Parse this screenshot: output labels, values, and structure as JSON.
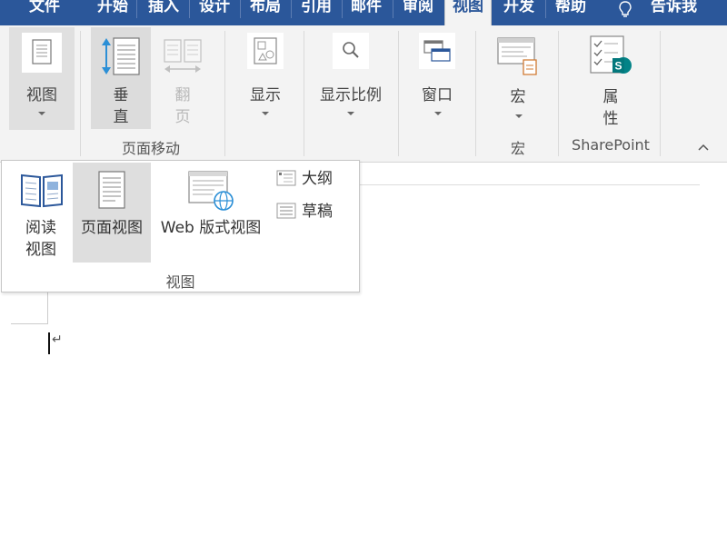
{
  "menu": {
    "tabs": [
      {
        "label": "文件",
        "active": false
      },
      {
        "label": "开始",
        "active": false
      },
      {
        "label": "插入",
        "active": false
      },
      {
        "label": "设计",
        "active": false
      },
      {
        "label": "布局",
        "active": false
      },
      {
        "label": "引用",
        "active": false
      },
      {
        "label": "邮件",
        "active": false
      },
      {
        "label": "审阅",
        "active": false
      },
      {
        "label": "视图",
        "active": true
      },
      {
        "label": "开发",
        "active": false
      },
      {
        "label": "帮助",
        "active": false
      }
    ],
    "tell_me": "告诉我",
    "tell_me_icon": "lightbulb-icon"
  },
  "ribbon": {
    "view_button": {
      "label": "视图",
      "icon": "document-view-icon"
    },
    "page_movement": {
      "group_label": "页面移动",
      "vertical": {
        "label_line1": "垂",
        "label_line2": "直",
        "icon": "vertical-scroll-icon"
      },
      "side_to_side": {
        "label_line1": "翻",
        "label_line2": "页",
        "icon": "side-by-side-icon",
        "enabled": false
      }
    },
    "show_button": {
      "label": "显示",
      "icon": "show-icon"
    },
    "zoom_button": {
      "label": "显示比例",
      "icon": "zoom-icon"
    },
    "window_button": {
      "label": "窗口",
      "icon": "window-icon"
    },
    "macros": {
      "button_label": "宏",
      "group_label": "宏",
      "icon": "macro-icon"
    },
    "sharepoint": {
      "button_line1": "属",
      "button_line2": "性",
      "group_label": "SharePoint",
      "icon": "sharepoint-properties-icon"
    },
    "collapse_icon": "chevron-up-icon"
  },
  "views_panel": {
    "group_label": "视图",
    "read_mode": {
      "label_line1": "阅读",
      "label_line2": "视图",
      "icon": "book-open-icon"
    },
    "print_layout": {
      "label": "页面视图",
      "icon": "page-icon",
      "selected": true
    },
    "web_layout": {
      "label": "Web 版式视图",
      "icon": "web-layout-icon"
    },
    "outline": {
      "label": "大纲",
      "icon": "outline-icon"
    },
    "draft": {
      "label": "草稿",
      "icon": "draft-icon"
    }
  },
  "colors": {
    "accent": "#2b579a",
    "ribbon_bg": "#f3f3f3",
    "highlight": "#dcdcdc",
    "sharepoint_teal": "#038387"
  }
}
